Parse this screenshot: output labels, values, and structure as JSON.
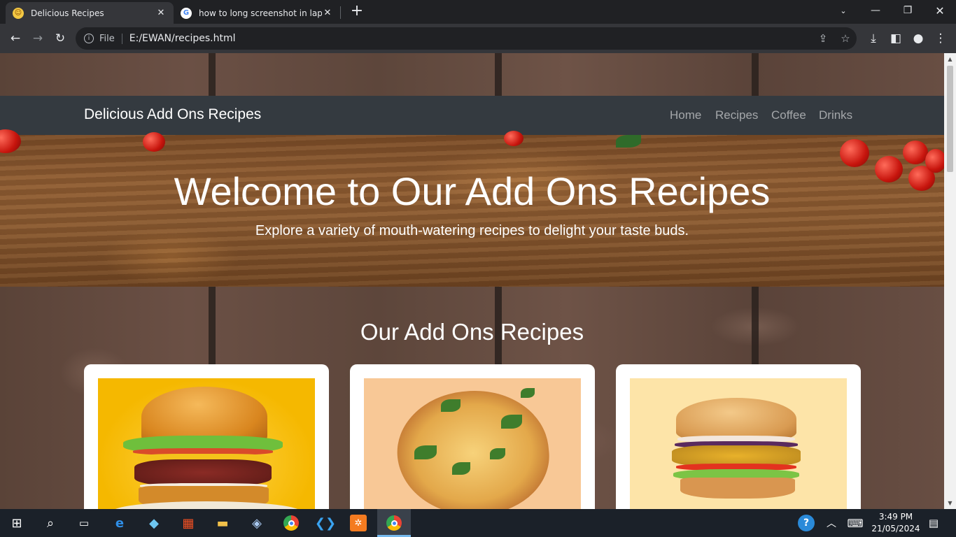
{
  "browser": {
    "tabs": [
      {
        "title": "Delicious Recipes",
        "active": true
      },
      {
        "title": "how to long screenshot in laptop",
        "active": false
      }
    ],
    "address": {
      "chip": "File",
      "url": "E:/EWAN/recipes.html"
    }
  },
  "page": {
    "navbar": {
      "brand": "Delicious Add Ons Recipes",
      "links": [
        "Home",
        "Recipes",
        "Coffee",
        "Drinks"
      ]
    },
    "hero": {
      "title": "Welcome to Our Add Ons Recipes",
      "subtitle": "Explore a variety of mouth-watering recipes to delight your taste buds."
    },
    "section": {
      "title": "Our Add Ons Recipes"
    },
    "cards": [
      {
        "image": "veggie-burger-photo"
      },
      {
        "image": "flatbread-pizza-photo"
      },
      {
        "image": "bean-burger-photo"
      }
    ]
  },
  "taskbar": {
    "time": "3:49 PM",
    "date": "21/05/2024"
  },
  "colors": {
    "navbar": "#343a40",
    "taskbar": "#1b2129",
    "browser_frame": "#202124",
    "toolbar": "#35363a"
  }
}
